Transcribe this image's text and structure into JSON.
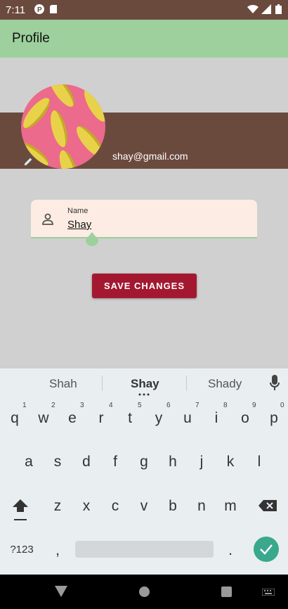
{
  "status_bar": {
    "time": "7:11"
  },
  "app_bar": {
    "title": "Profile"
  },
  "profile": {
    "email": "shay@gmail.com"
  },
  "name_field": {
    "label": "Name",
    "value": "Shay"
  },
  "save_button": {
    "label": "SAVE CHANGES"
  },
  "keyboard": {
    "suggestions": [
      "Shah",
      "Shay",
      "Shady"
    ],
    "row1": [
      "q",
      "w",
      "e",
      "r",
      "t",
      "y",
      "u",
      "i",
      "o",
      "p"
    ],
    "row1_hints": [
      "1",
      "2",
      "3",
      "4",
      "5",
      "6",
      "7",
      "8",
      "9",
      "0"
    ],
    "row2": [
      "a",
      "s",
      "d",
      "f",
      "g",
      "h",
      "j",
      "k",
      "l"
    ],
    "row3": [
      "z",
      "x",
      "c",
      "v",
      "b",
      "n",
      "m"
    ],
    "symbols_label": "?123",
    "comma": ",",
    "period": "."
  },
  "colors": {
    "app_bar": "#9dd09c",
    "header": "#6b4a3e",
    "button": "#a31830",
    "enter_key": "#3aa88c"
  }
}
